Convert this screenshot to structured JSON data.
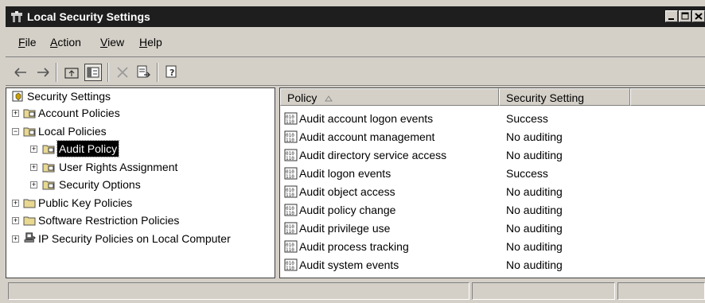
{
  "window": {
    "title": "Local Security Settings"
  },
  "menu": [
    {
      "label": "File",
      "key": "F",
      "rest": "ile"
    },
    {
      "label": "Action",
      "key": "A",
      "rest": "ction"
    },
    {
      "label": "View",
      "key": "V",
      "rest": "iew"
    },
    {
      "label": "Help",
      "key": "H",
      "rest": "elp"
    }
  ],
  "toolbar": {
    "buttons": [
      "back-arrow-icon",
      "forward-arrow-icon",
      "up-folder-icon",
      "show-hide-tree-icon",
      "delete-icon",
      "export-list-icon",
      "help-icon"
    ]
  },
  "tree": {
    "root": "Security Settings",
    "account_policies": "Account Policies",
    "local_policies": "Local Policies",
    "audit_policy": "Audit Policy",
    "user_rights": "User Rights Assignment",
    "security_options": "Security Options",
    "public_key": "Public Key Policies",
    "software_restriction": "Software Restriction Policies",
    "ip_security": "IP Security Policies on Local Computer"
  },
  "list": {
    "columns": {
      "policy": "Policy",
      "setting": "Security Setting"
    },
    "rows": [
      {
        "policy": "Audit account logon events",
        "setting": "Success"
      },
      {
        "policy": "Audit account management",
        "setting": "No auditing"
      },
      {
        "policy": "Audit directory service access",
        "setting": "No auditing"
      },
      {
        "policy": "Audit logon events",
        "setting": "Success"
      },
      {
        "policy": "Audit object access",
        "setting": "No auditing"
      },
      {
        "policy": "Audit policy change",
        "setting": "No auditing"
      },
      {
        "policy": "Audit privilege use",
        "setting": "No auditing"
      },
      {
        "policy": "Audit process tracking",
        "setting": "No auditing"
      },
      {
        "policy": "Audit system events",
        "setting": "No auditing"
      }
    ]
  },
  "colors": {
    "titlebar": "#1e1e1e",
    "face": "#d4d0c8",
    "selection": "#000000"
  }
}
